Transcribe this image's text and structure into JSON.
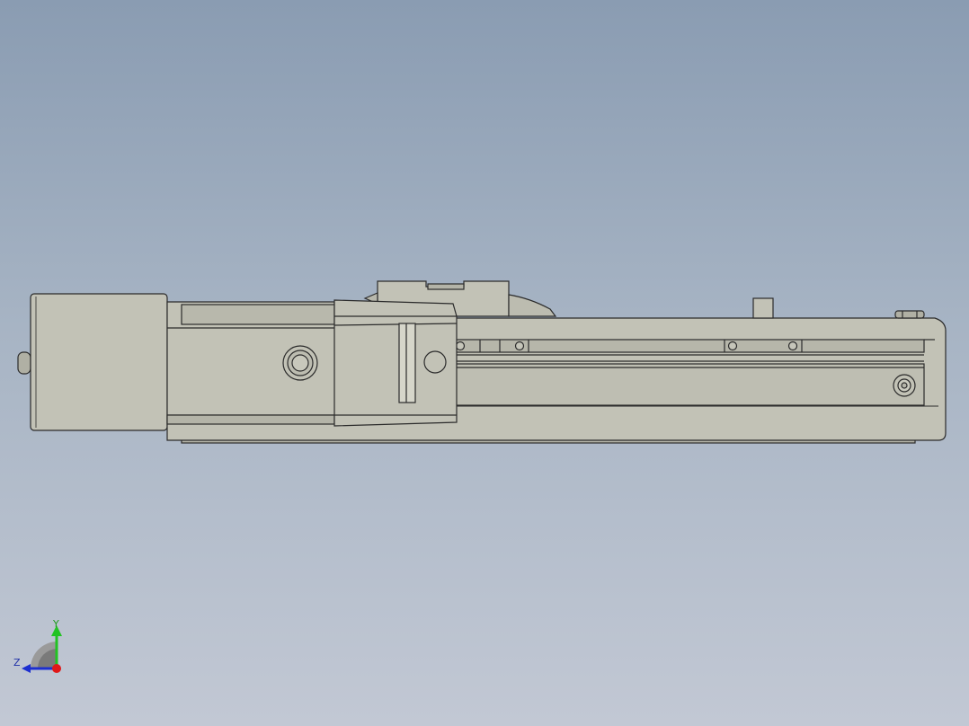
{
  "viewport": {
    "background_top": "#8a9cb2",
    "background_bottom": "#c2c8d4"
  },
  "model": {
    "name": "linear-actuator-module",
    "body_color": "#c2c2b6",
    "shadow_color": "#a6a69a",
    "edge_color": "#2b2b2b"
  },
  "triad": {
    "y_label": "Y",
    "z_label": "Z",
    "y_color": "#22c322",
    "z_color": "#1c2fd0",
    "origin_color": "#e01818",
    "arc_color": "#9a9a9a"
  }
}
